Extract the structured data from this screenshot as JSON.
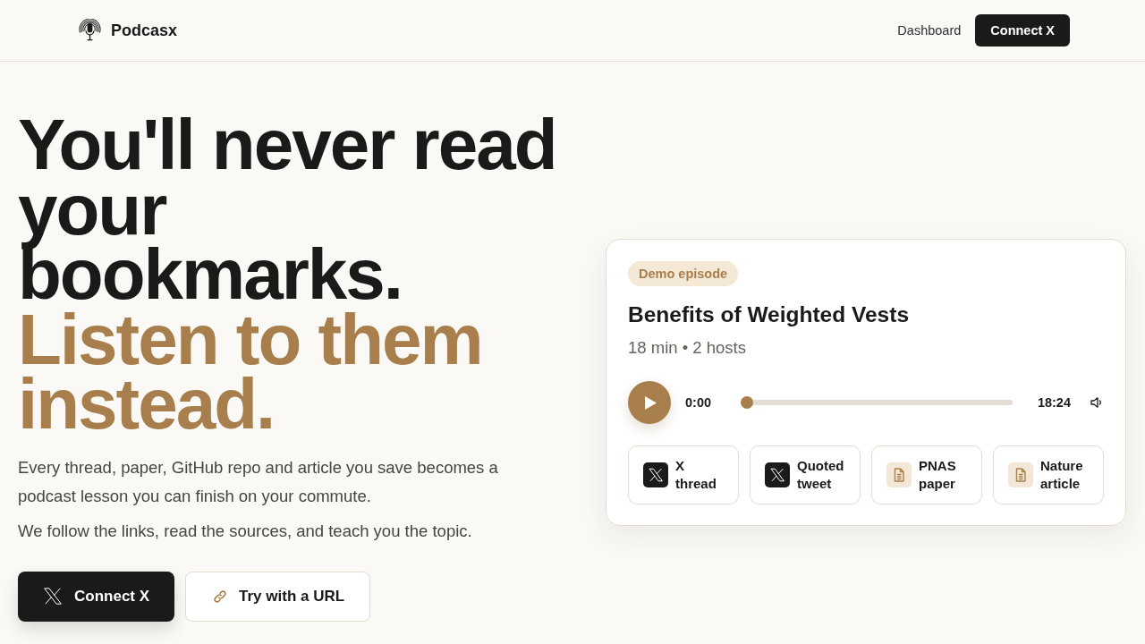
{
  "header": {
    "brand": "Podcasx",
    "nav_link": "Dashboard",
    "cta": "Connect X"
  },
  "hero": {
    "headline": "You'll never read your bookmarks.",
    "headline_accent": "Listen to them instead.",
    "paragraphs": [
      "Every thread, paper, GitHub repo and article you save becomes a podcast lesson you can finish on your commute.",
      "We follow the links, read the sources, and teach you the topic."
    ],
    "buttons": [
      {
        "kind": "primary",
        "label": "Connect X"
      },
      {
        "kind": "secondary",
        "label": "Try with a URL"
      }
    ]
  },
  "player_card": {
    "badge": "Demo episode",
    "title": "Benefits of Weighted Vests",
    "meta": "18 min • 2 hosts",
    "current_time": "0:00",
    "progress": {
      "level": 0
    },
    "duration": "18:24",
    "sources": [
      {
        "kind": "x",
        "label": "X thread"
      },
      {
        "kind": "x",
        "label": "Quoted tweet"
      },
      {
        "kind": "document",
        "label": "PNAS paper"
      },
      {
        "kind": "document",
        "label": "Nature article"
      }
    ]
  }
}
